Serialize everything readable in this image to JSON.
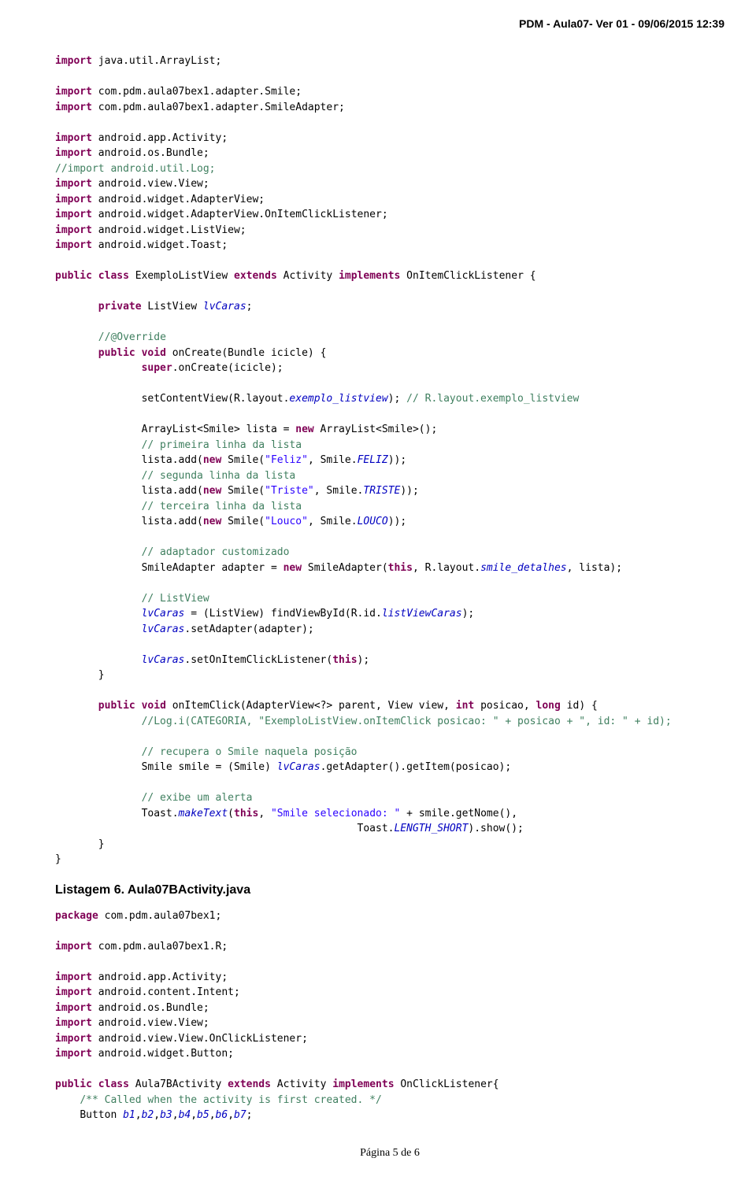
{
  "header": "PDM - Aula07- Ver 01 -  09/06/2015 12:39",
  "listing_title": "Listagem 6. Aula07BActivity.java",
  "footer": "Página 5 de 6",
  "code1": {
    "l1_kw1": "import",
    "l1_txt": " java.util.ArrayList;",
    "l2_kw1": "import",
    "l2_txt": " com.pdm.aula07bex1.adapter.Smile;",
    "l3_kw1": "import",
    "l3_txt": " com.pdm.aula07bex1.adapter.SmileAdapter;",
    "l4_kw1": "import",
    "l4_txt": " android.app.Activity;",
    "l5_kw1": "import",
    "l5_txt": " android.os.Bundle;",
    "l6_cm": "//import android.util.Log;",
    "l7_kw1": "import",
    "l7_txt": " android.view.View;",
    "l8_kw1": "import",
    "l8_txt": " android.widget.AdapterView;",
    "l9_kw1": "import",
    "l9_txt": " android.widget.AdapterView.OnItemClickListener;",
    "l10_kw1": "import",
    "l10_txt": " android.widget.ListView;",
    "l11_kw1": "import",
    "l11_txt": " android.widget.Toast;",
    "l12_kw1": "public",
    "l12_kw2": "class",
    "l12_txt1": " ExemploListView ",
    "l12_kw3": "extends",
    "l12_txt2": " Activity ",
    "l12_kw4": "implements",
    "l12_txt3": " OnItemClickListener {",
    "l13_kw1": "private",
    "l13_txt1": " ListView ",
    "l13_st1": "lvCaras",
    "l13_txt2": ";",
    "l14_cm": "//@Override",
    "l15_kw1": "public",
    "l15_kw2": "void",
    "l15_txt": " onCreate(Bundle icicle) {",
    "l16_kw1": "super",
    "l16_txt": ".onCreate(icicle);",
    "l17_txt1": "setContentView(R.layout.",
    "l17_st": "exemplo_listview",
    "l17_txt2": "); ",
    "l17_cm": "// R.layout.exemplo_listview",
    "l18a_txt1": "ArrayList<Smile> lista = ",
    "l18a_kw": "new",
    "l18a_txt2": " ArrayList<Smile>();",
    "l18_cm": "// primeira linha da lista",
    "l19_txt1": "lista.add(",
    "l19_kw": "new",
    "l19_txt2": " Smile(",
    "l19_str": "\"Feliz\"",
    "l19_txt3": ", Smile.",
    "l19_st": "FELIZ",
    "l19_txt4": "));",
    "l20_cm": "// segunda linha da lista",
    "l21_txt1": "lista.add(",
    "l21_kw": "new",
    "l21_txt2": " Smile(",
    "l21_str": "\"Triste\"",
    "l21_txt3": ", Smile.",
    "l21_st": "TRISTE",
    "l21_txt4": "));",
    "l22_cm": "// terceira linha da lista",
    "l23_txt1": "lista.add(",
    "l23_kw": "new",
    "l23_txt2": " Smile(",
    "l23_str": "\"Louco\"",
    "l23_txt3": ", Smile.",
    "l23_st": "LOUCO",
    "l23_txt4": "));",
    "l24_cm": "// adaptador customizado",
    "l25_txt1": "SmileAdapter adapter = ",
    "l25_kw": "new",
    "l25_txt2": " SmileAdapter(",
    "l25_kw2": "this",
    "l25_txt3": ", R.layout.",
    "l25_st": "smile_detalhes",
    "l25_txt4": ", lista);",
    "l26_cm": "// ListView",
    "l27_st1": "lvCaras",
    "l27_txt1": " = (ListView) findViewById(R.id.",
    "l27_st2": "listViewCaras",
    "l27_txt2": ");",
    "l28_st1": "lvCaras",
    "l28_txt": ".setAdapter(adapter);",
    "l29_st1": "lvCaras",
    "l29_txt": ".setOnItemClickListener(",
    "l29_kw": "this",
    "l29_txt2": ");",
    "l30": "}",
    "l31_kw1": "public",
    "l31_kw2": "void",
    "l31_txt1": " onItemClick(AdapterView<?> parent, View view, ",
    "l31_kw3": "int",
    "l31_txt2": " posicao, ",
    "l31_kw4": "long",
    "l31_txt3": " id) {",
    "l32_cm": "//Log.i(CATEGORIA, \"ExemploListView.onItemClick posicao: \" + posicao + \", id: \" + id);",
    "l33_cm": "// recupera o Smile naquela posição",
    "l34_txt1": "Smile smile = (Smile) ",
    "l34_st1": "lvCaras",
    "l34_txt2": ".getAdapter().getItem(posicao);",
    "l35_cm": "// exibe um alerta",
    "l36_txt1": "Toast.",
    "l36_st1": "makeText",
    "l36_txt2": "(",
    "l36_kw": "this",
    "l36_txt3": ", ",
    "l36_str": "\"Smile selecionado: \"",
    "l36_txt4": " + smile.getNome(),",
    "l37_txt1": "Toast.",
    "l37_st1": "LENGTH_SHORT",
    "l37_txt2": ").show();",
    "l38": "}",
    "l39": "}"
  },
  "code2": {
    "l1_kw": "package",
    "l1_txt": " com.pdm.aula07bex1;",
    "l2_kw": "import",
    "l2_txt": " com.pdm.aula07bex1.R;",
    "l3_kw": "import",
    "l3_txt": " android.app.Activity;",
    "l4_kw": "import",
    "l4_txt": " android.content.Intent;",
    "l5_kw": "import",
    "l5_txt": " android.os.Bundle;",
    "l6_kw": "import",
    "l6_txt": " android.view.View;",
    "l7_kw": "import",
    "l7_txt": " android.view.View.OnClickListener;",
    "l8_kw": "import",
    "l8_txt": " android.widget.Button;",
    "l9_kw1": "public",
    "l9_kw2": "class",
    "l9_txt1": " Aula7BActivity ",
    "l9_kw3": "extends",
    "l9_txt2": " Activity ",
    "l9_kw4": "implements",
    "l9_txt3": " OnClickListener{",
    "l10_cm": "/** Called when the activity is first created. */",
    "l11_txt1": "Button ",
    "l11_st1": "b1",
    "l11_c": ",",
    "l11_st2": "b2",
    "l11_st3": "b3",
    "l11_st4": "b4",
    "l11_st5": "b5",
    "l11_st6": "b6",
    "l11_st7": "b7",
    "l11_txt2": ";"
  }
}
